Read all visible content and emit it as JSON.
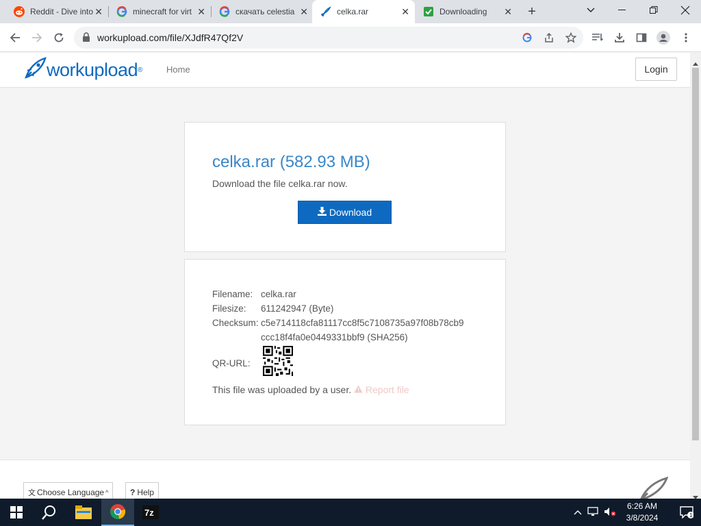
{
  "browser": {
    "tabs": [
      {
        "title": "Reddit - Dive into",
        "icon": "reddit-icon"
      },
      {
        "title": "minecraft for virt",
        "icon": "google-icon"
      },
      {
        "title": "скачать celestia",
        "icon": "google-icon"
      },
      {
        "title": "celka.rar",
        "icon": "workupload-icon"
      },
      {
        "title": "Downloading",
        "icon": "download-check-icon"
      }
    ],
    "url": "workupload.com/file/XJdfR47Qf2V"
  },
  "site": {
    "logo_text": "workupload",
    "logo_mark": "®",
    "nav_home": "Home",
    "login_label": "Login"
  },
  "file": {
    "title": "celka.rar (582.93 MB)",
    "subtitle": "Download the file celka.rar now.",
    "download_label": "Download",
    "filename_label": "Filename:",
    "filename": "celka.rar",
    "filesize_label": "Filesize:",
    "filesize": "611242947 (Byte)",
    "checksum_label": "Checksum:",
    "checksum_line1": "c5e714118cfa81117cc8f5c7108735a97f08b78cb9",
    "checksum_line2": "ccc18f4fa0e0449331bbf9 (SHA256)",
    "qr_label": "QR-URL:",
    "uploaded_text": "This file was uploaded by a user.",
    "report_label": "Report file"
  },
  "footer": {
    "language_label": "Choose Language",
    "help_label": "Help"
  },
  "taskbar": {
    "time": "6:26 AM",
    "date": "3/8/2024",
    "notification_count": "1"
  },
  "colors": {
    "brand": "#0e6ac0",
    "title": "#3a87c8",
    "taskbar": "#0f1b2a"
  }
}
